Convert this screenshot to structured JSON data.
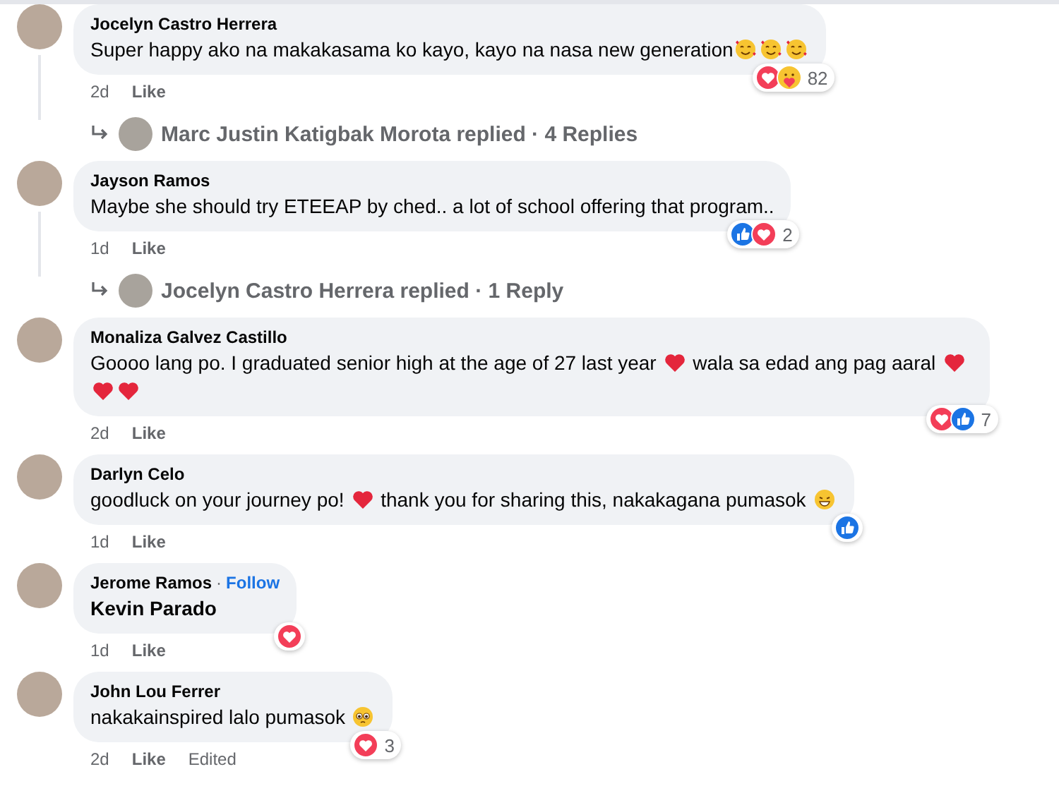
{
  "comments": [
    {
      "author": "Jocelyn Castro Herrera",
      "body": [
        {
          "kind": "text",
          "text": "Super happy ako na makakasama ko kayo, kayo na nasa new generation"
        },
        {
          "kind": "hearts-face"
        },
        {
          "kind": "hearts-face"
        },
        {
          "kind": "hearts-face"
        }
      ],
      "time": "2d",
      "like": "Like",
      "reactions": [
        {
          "kind": "love"
        },
        {
          "kind": "care"
        }
      ],
      "reaction_count": "82",
      "replies": {
        "author": "Marc Justin Katigbak Morota",
        "text": "replied · 4 Replies"
      }
    },
    {
      "author": "Jayson Ramos",
      "body": [
        {
          "kind": "text",
          "text": "Maybe she should try ETEEAP by ched.. a lot of school offering that program.."
        }
      ],
      "time": "1d",
      "like": "Like",
      "reactions": [
        {
          "kind": "like"
        },
        {
          "kind": "love"
        }
      ],
      "reaction_count": "2",
      "replies": {
        "author": "Jocelyn Castro Herrera",
        "text": "replied · 1 Reply"
      }
    },
    {
      "author": "Monaliza Galvez Castillo",
      "body": [
        {
          "kind": "text",
          "text": "Goooo lang po. I graduated senior high at the age of 27 last year "
        },
        {
          "kind": "heart"
        },
        {
          "kind": "text",
          "text": " wala sa edad ang pag aaral "
        },
        {
          "kind": "heart"
        },
        {
          "kind": "heart"
        },
        {
          "kind": "heart"
        }
      ],
      "time": "2d",
      "like": "Like",
      "reactions": [
        {
          "kind": "love"
        },
        {
          "kind": "like"
        }
      ],
      "reaction_count": "7"
    },
    {
      "author": "Darlyn Celo",
      "body": [
        {
          "kind": "text",
          "text": "goodluck on your journey po! "
        },
        {
          "kind": "heart"
        },
        {
          "kind": "text",
          "text": " thank you for sharing this, nakakagana pumasok "
        },
        {
          "kind": "grin-face"
        }
      ],
      "time": "1d",
      "like": "Like",
      "reactions": [
        {
          "kind": "like"
        }
      ]
    },
    {
      "author": "Jerome Ramos",
      "separator": "·",
      "follow": "Follow",
      "body": [
        {
          "kind": "mention",
          "text": "Kevin Parado"
        }
      ],
      "time": "1d",
      "like": "Like",
      "reactions": [
        {
          "kind": "love"
        }
      ]
    },
    {
      "author": "John Lou Ferrer",
      "body": [
        {
          "kind": "text",
          "text": "nakakainspired lalo pumasok "
        },
        {
          "kind": "pleading-face"
        }
      ],
      "time": "2d",
      "like": "Like",
      "edited": "Edited",
      "reactions": [
        {
          "kind": "love"
        }
      ],
      "reaction_count": "3"
    }
  ]
}
